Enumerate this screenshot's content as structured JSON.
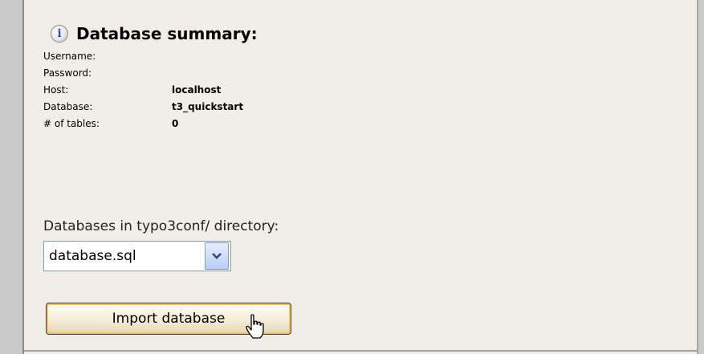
{
  "summary": {
    "title": "Database summary:",
    "rows": [
      {
        "label": "Username:",
        "value": ""
      },
      {
        "label": "Password:",
        "value": ""
      },
      {
        "label": "Host:",
        "value": "localhost"
      },
      {
        "label": "Database:",
        "value": "t3_quickstart"
      },
      {
        "label": "# of tables:",
        "value": "0"
      }
    ]
  },
  "databases": {
    "label": "Databases in typo3conf/ directory:",
    "selected": "database.sql"
  },
  "import_button": "Import database",
  "icons": {
    "info": "info-icon",
    "dropdown": "chevron-down-icon",
    "cursor": "hand-pointer-icon"
  },
  "colors": {
    "panel_bg": "#f1eee8",
    "button_focus": "#f5c060",
    "info_letter": "#1f4fd0"
  }
}
